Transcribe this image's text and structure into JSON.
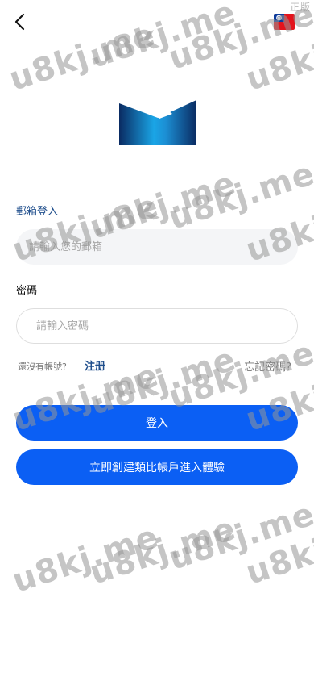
{
  "header": {
    "corner_label": "正版",
    "back_icon": "chevron-left-icon",
    "flag_icon": "taiwan-flag-icon"
  },
  "logo": {
    "icon": "brand-logo-icon"
  },
  "form": {
    "email_label": "郵箱登入",
    "email_placeholder": "請輸入您的郵箱",
    "password_label": "密碼",
    "password_placeholder": "請輸入密碼",
    "no_account_text": "還沒有帳號?",
    "register_link": "注册",
    "forgot_link": "忘記密碼?"
  },
  "buttons": {
    "login": "登入",
    "demo": "立即創建類比帳戶進入體驗"
  },
  "watermark": {
    "text": "u8kj.me"
  },
  "colors": {
    "primary": "#0b5ff4",
    "link": "#1f4e8c",
    "input_bg": "#f4f5f7"
  }
}
